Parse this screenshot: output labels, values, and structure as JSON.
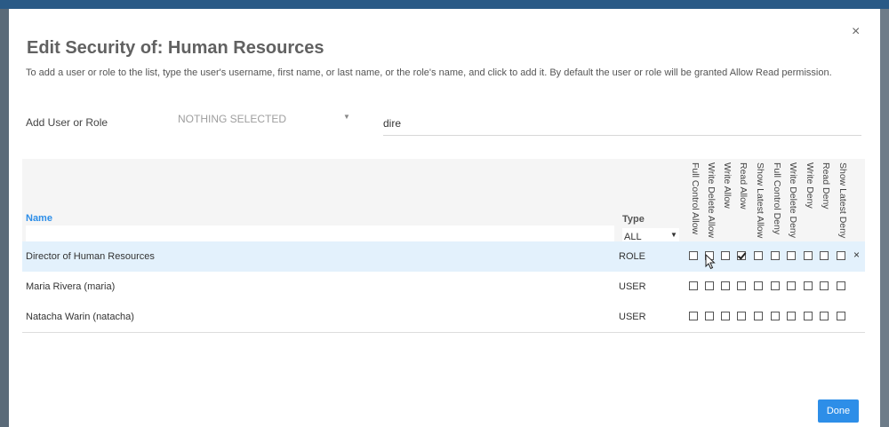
{
  "dialog": {
    "title": "Edit Security of: Human Resources",
    "description": "To add a user or role to the list, type the user's username, first name, or last name, or the role's name, and click to add it. By default the user or role will be granted Allow Read permission.",
    "close_glyph": "×",
    "add_label": "Add User or Role",
    "select_value": "NOTHING SELECTED",
    "search_value": "dire",
    "done_label": "Done"
  },
  "grid": {
    "name_header": "Name",
    "type_header": "Type",
    "type_filter": "ALL",
    "name_filter": "",
    "permissions": [
      "Full Control Allow",
      "Write Delete Allow",
      "Write Allow",
      "Read Allow",
      "Show Latest Allow",
      "Full Control Deny",
      "Write Delete Deny",
      "Write Deny",
      "Read Deny",
      "Show Latest Deny"
    ],
    "rows": [
      {
        "name": "Director of Human Resources",
        "type": "ROLE",
        "selected": true,
        "remove_glyph": "×",
        "checks": [
          false,
          false,
          false,
          true,
          false,
          false,
          false,
          false,
          false,
          false
        ]
      },
      {
        "name": "Maria Rivera (maria)",
        "type": "USER",
        "selected": false,
        "checks": [
          false,
          false,
          false,
          false,
          false,
          false,
          false,
          false,
          false,
          false
        ]
      },
      {
        "name": "Natacha Warin (natacha)",
        "type": "USER",
        "selected": false,
        "checks": [
          false,
          false,
          false,
          false,
          false,
          false,
          false,
          false,
          false,
          false
        ]
      }
    ]
  },
  "colors": {
    "accent": "#2d8ee8",
    "selected_row": "#e3f1fc",
    "header_bg": "#f5f5f5"
  },
  "icons": {
    "close": "close-icon",
    "dropdown": "chevron-down-icon",
    "cursor": "mouse-pointer-icon"
  }
}
